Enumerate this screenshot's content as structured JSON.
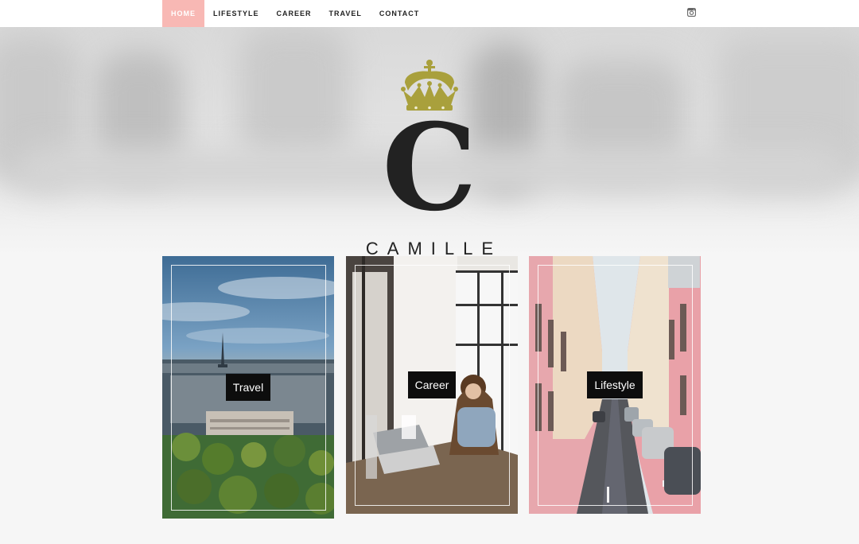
{
  "nav": {
    "items": [
      {
        "label": "HOME",
        "active": true
      },
      {
        "label": "LIFESTYLE",
        "active": false
      },
      {
        "label": "CAREER",
        "active": false
      },
      {
        "label": "TRAVEL",
        "active": false
      },
      {
        "label": "CONTACT",
        "active": false
      }
    ],
    "social_icon": "instagram-icon",
    "active_color": "#f8b8b4"
  },
  "hero": {
    "logo_letter": "C",
    "logo_name": "CAMILLE",
    "crown_color": "#a9a03c"
  },
  "cards": [
    {
      "label": "Travel",
      "image": "paris-eiffel-tower-photo"
    },
    {
      "label": "Career",
      "image": "woman-working-laptop-photo"
    },
    {
      "label": "Lifestyle",
      "image": "pink-street-cars-photo"
    }
  ]
}
